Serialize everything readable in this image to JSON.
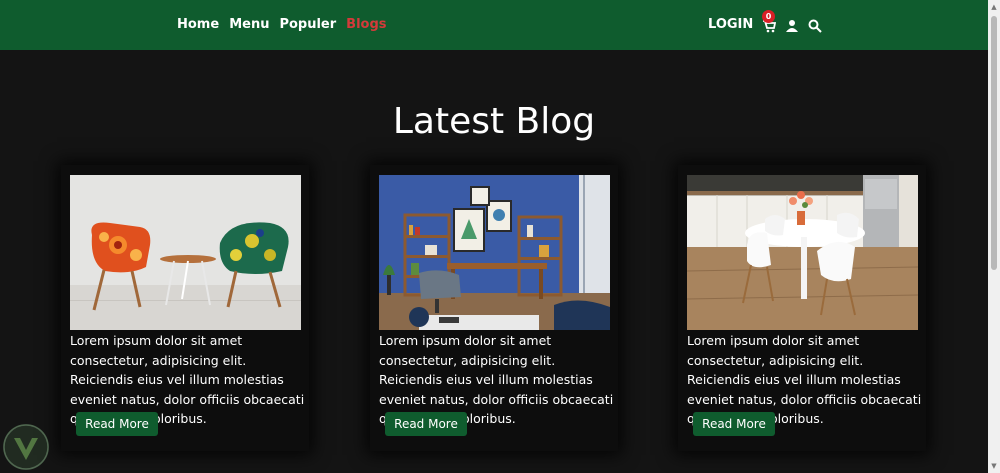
{
  "nav": {
    "links": [
      {
        "label": "Home"
      },
      {
        "label": "Menu"
      },
      {
        "label": "Populer"
      },
      {
        "label": "Blogs"
      }
    ],
    "login_label": "LOGIN",
    "cart_count": "0",
    "icons": [
      "cart-icon",
      "user-icon",
      "search-icon"
    ],
    "colors": {
      "nav_bg": "#0f5c2e",
      "active_link": "#d43a3a",
      "badge": "#d81f26"
    }
  },
  "blog": {
    "title": "Latest Blog",
    "cards": [
      {
        "image": "orange-and-green-chairs-photo",
        "text": "Lorem ipsum dolor sit amet consectetur, adipisicing elit. Reiciendis eius vel illum molestias eveniet natus, dolor officiis obcaecati quod quam doloribus.",
        "button": "Read More"
      },
      {
        "image": "blue-wall-office-room-photo",
        "text": "Lorem ipsum dolor sit amet consectetur, adipisicing elit. Reiciendis eius vel illum molestias eveniet natus, dolor officiis obcaecati quod quam doloribus.",
        "button": "Read More"
      },
      {
        "image": "white-dining-table-kitchen-photo",
        "text": "Lorem ipsum dolor sit amet consectetur, adipisicing elit. Reiciendis eius vel illum molestias eveniet natus, dolor officiis obcaecati quod quam doloribus.",
        "button": "Read More"
      }
    ]
  }
}
